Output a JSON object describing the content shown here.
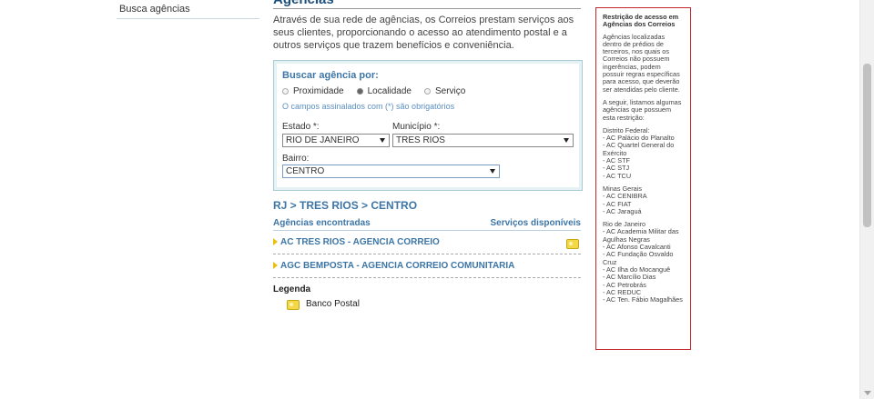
{
  "left_nav": {
    "items": [
      "Busca agências"
    ]
  },
  "main": {
    "title": "Agências",
    "intro": "Através de sua rede de agências, os Correios prestam serviços aos seus clientes, proporcionando o acesso ao atendimento postal e a outros serviços que trazem benefícios e conveniência."
  },
  "search": {
    "title": "Buscar agência por:",
    "options": [
      "Proximidade",
      "Localidade",
      "Serviço"
    ],
    "selected": "Localidade",
    "note": "O campos assinalados com (*) são obrigatórios",
    "estado_label": "Estado *:",
    "estado_value": "RIO DE JANEIRO",
    "municipio_label": "Município *:",
    "municipio_value": "TRES RIOS",
    "bairro_label": "Bairro:",
    "bairro_value": "CENTRO"
  },
  "results": {
    "breadcrumb": "RJ > TRES RIOS > CENTRO",
    "col_left": "Agências encontradas",
    "col_right": "Serviços disponíveis",
    "rows": [
      {
        "name": "AC TRES RIOS - AGENCIA CORREIO",
        "service_icon": "banco-postal-icon"
      },
      {
        "name": "AGC BEMPOSTA - AGENCIA CORREIO COMUNITARIA",
        "service_icon": ""
      }
    ]
  },
  "legend": {
    "title": "Legenda",
    "items": [
      {
        "icon": "banco-postal-icon",
        "label": "Banco Postal"
      }
    ]
  },
  "sidebar": {
    "title": "Restrição de acesso em Agências dos Correios",
    "p1": "Agências localizadas dentro de prédios de terceiros, nos quais os Correios não possuem ingerências, podem possuir regras específicas para acesso, que deverão ser atendidas pelo cliente.",
    "p2": "A seguir, listamos algumas agências que possuem esta restrição:",
    "groups": [
      {
        "name": "Distrito Federal:",
        "items": [
          "- AC Palácio do Planalto",
          "- AC Quartel General do Exército",
          "- AC STF",
          "- AC STJ",
          "- AC TCU"
        ]
      },
      {
        "name": "Minas Gerais",
        "items": [
          "- AC CENIBRA",
          "- AC FIAT",
          "- AC Jaraguá"
        ]
      },
      {
        "name": "Rio de Janeiro",
        "items": [
          "- AC Academia Militar das Agulhas Negras",
          "- AC Afonso Cavalcanti",
          "- AC Fundação Osvaldo Cruz",
          "- AC Ilha do Mocanguê",
          "- AC Marcílio Dias",
          "- AC Petrobrás",
          "- AC REDUC",
          "- AC Ten. Fábio Magalhães"
        ]
      }
    ]
  },
  "colors": {
    "link_blue": "#3d76a6",
    "title_blue": "#1c4f7c",
    "sidebar_border": "#c1272d",
    "icon_yellow": "#f3d94a"
  }
}
